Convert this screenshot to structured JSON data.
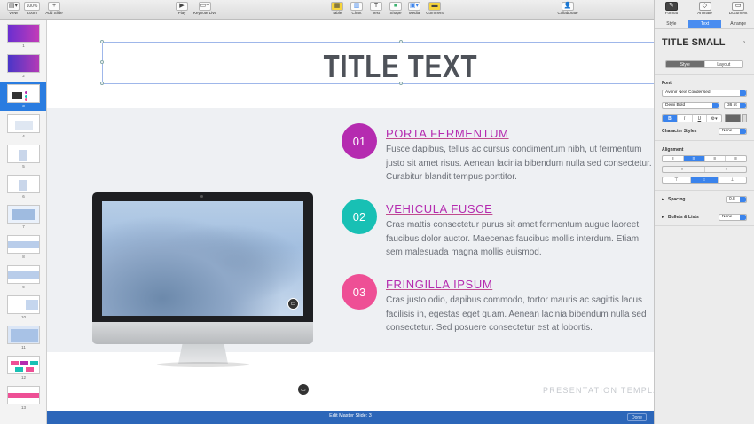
{
  "toolbar": {
    "view": "View",
    "zoom_value": "100%",
    "zoom": "Zoom",
    "add_slide": "Add Slide",
    "play": "Play",
    "keynote_live": "Keynote Live",
    "table": "Table",
    "chart": "Chart",
    "text": "Text",
    "shape": "Shape",
    "media": "Media",
    "comment": "Comment",
    "collaborate": "Collaborate",
    "format": "Format",
    "animate": "Animate",
    "document": "Document"
  },
  "navigator": {
    "slides": [
      {
        "num": "1"
      },
      {
        "num": "2"
      },
      {
        "num": "3"
      },
      {
        "num": "4"
      },
      {
        "num": "5"
      },
      {
        "num": "6"
      },
      {
        "num": "7"
      },
      {
        "num": "8"
      },
      {
        "num": "9"
      },
      {
        "num": "10"
      },
      {
        "num": "11"
      },
      {
        "num": "12"
      },
      {
        "num": "13"
      }
    ],
    "selected": "3"
  },
  "slide": {
    "title": "TITLE TEXT",
    "features": [
      {
        "number": "01",
        "title": "PORTA FERMENTUM",
        "color": "#b52bb0",
        "lines": [
          "Fusce dapibus, tellus ac cursus condimentum nibh, ut fermentum",
          "justo sit amet risus. Aenean lacinia bibendum nulla sed consectetur.",
          "Curabitur blandit tempus porttitor."
        ]
      },
      {
        "number": "02",
        "title": "VEHICULA FUSCE",
        "color": "#18c0b4",
        "lines": [
          "Cras mattis consectetur purus sit amet fermentum augue laoreet",
          "faucibus dolor auctor. Maecenas faucibus mollis interdum. Etiam",
          "sem malesuada magna mollis euismod."
        ]
      },
      {
        "number": "03",
        "title": "FRINGILLA IPSUM",
        "color": "#ee4f95",
        "lines": [
          "Cras justo odio, dapibus commodo, tortor mauris ac sagittis lacus",
          "facilisis in, egestas eget quam. Aenean lacinia bibendum nulla sed",
          "consectetur. Sed posuere consectetur est at lobortis."
        ]
      }
    ],
    "footer": "PRESENTATION TEMPLATE"
  },
  "status": {
    "text": "Edit Master Slide: 3",
    "done": "Done"
  },
  "inspector": {
    "tabs": [
      "Style",
      "Text",
      "Arrange"
    ],
    "active_tab": "Text",
    "paragraph_style": "TITLE SMALL",
    "style_segments": [
      "Style",
      "Layout"
    ],
    "font_label": "Font",
    "font_family": "Avenir Next Condensed",
    "font_weight": "Demi Bold",
    "font_size": "36 pt",
    "char_buttons": [
      "B",
      "I",
      "U",
      "⚙▾"
    ],
    "character_styles_label": "Character Styles",
    "character_styles_value": "None",
    "alignment_label": "Alignment",
    "spacing_label": "Spacing",
    "spacing_value": "0.8",
    "bullets_label": "Bullets & Lists",
    "bullets_value": "None"
  },
  "colors": {
    "accent": "#3a83ec",
    "statusbar": "#2c66b9"
  }
}
